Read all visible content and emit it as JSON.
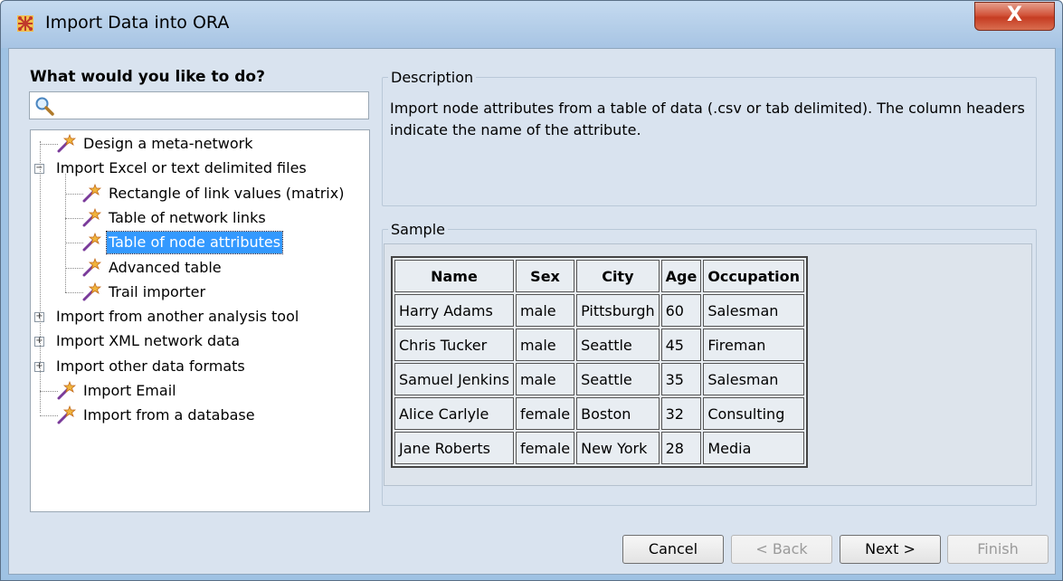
{
  "window": {
    "title": "Import Data into ORA",
    "close_label": "X"
  },
  "left": {
    "heading": "What would you like to do?",
    "search_value": "",
    "tree": [
      {
        "label": "Design a meta-network",
        "level": 0,
        "type": "leaf"
      },
      {
        "label": "Import Excel or text delimited files",
        "level": 0,
        "type": "expanded"
      },
      {
        "label": "Rectangle of link values (matrix)",
        "level": 1,
        "type": "leaf"
      },
      {
        "label": "Table of network links",
        "level": 1,
        "type": "leaf"
      },
      {
        "label": "Table of node attributes",
        "level": 1,
        "type": "leaf",
        "selected": true
      },
      {
        "label": "Advanced table",
        "level": 1,
        "type": "leaf"
      },
      {
        "label": "Trail importer",
        "level": 1,
        "type": "leaf"
      },
      {
        "label": "Import from another analysis tool",
        "level": 0,
        "type": "collapsed"
      },
      {
        "label": "Import XML network data",
        "level": 0,
        "type": "collapsed"
      },
      {
        "label": "Import other data formats",
        "level": 0,
        "type": "collapsed"
      },
      {
        "label": "Import Email",
        "level": 0,
        "type": "leaf"
      },
      {
        "label": "Import from a database",
        "level": 0,
        "type": "leaf"
      }
    ]
  },
  "description": {
    "label": "Description",
    "text": "Import node attributes from a table of data (.csv or tab delimited). The column headers indicate the name of the attribute."
  },
  "sample": {
    "label": "Sample",
    "columns": [
      "Name",
      "Sex",
      "City",
      "Age",
      "Occupation"
    ],
    "rows": [
      [
        "Harry Adams",
        "male",
        "Pittsburgh",
        "60",
        "Salesman"
      ],
      [
        "Chris Tucker",
        "male",
        "Seattle",
        "45",
        "Fireman"
      ],
      [
        "Samuel Jenkins",
        "male",
        "Seattle",
        "35",
        "Salesman"
      ],
      [
        "Alice Carlyle",
        "female",
        "Boston",
        "32",
        "Consulting"
      ],
      [
        "Jane Roberts",
        "female",
        "New York",
        "28",
        "Media"
      ]
    ]
  },
  "buttons": {
    "cancel": "Cancel",
    "back": "< Back",
    "next": "Next >",
    "finish": "Finish"
  }
}
